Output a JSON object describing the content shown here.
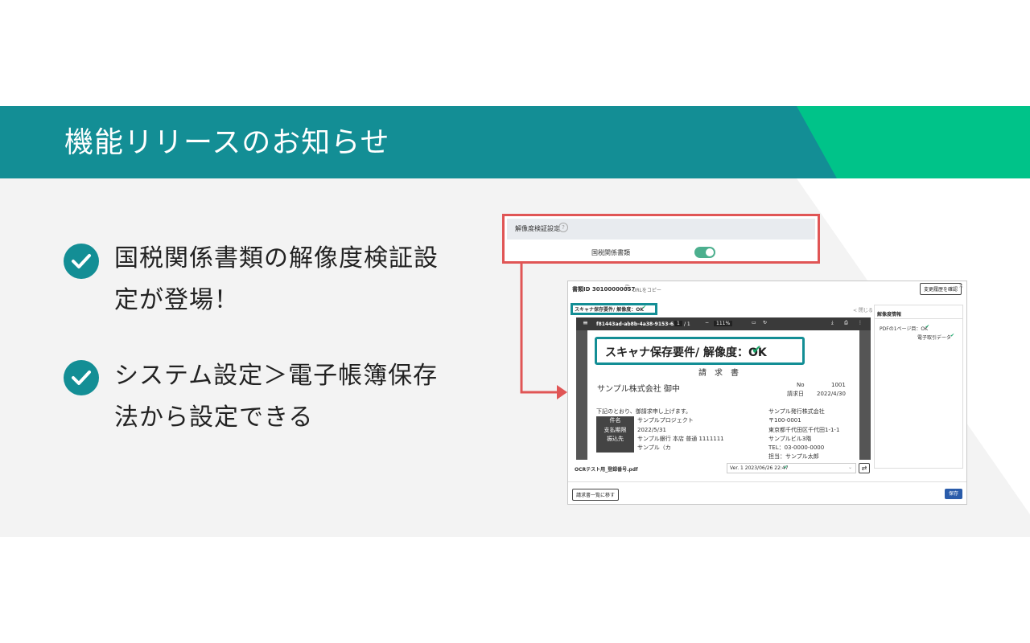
{
  "colors": {
    "teal": "#138e95",
    "green": "#00c389",
    "red_frame": "#e05555",
    "check": "#1aa86b"
  },
  "banner": {
    "title": "機能リリースのお知らせ"
  },
  "bullets": [
    {
      "icon": "check-circle-icon",
      "text": "国税関係書類の解像度検証設定が登場！"
    },
    {
      "icon": "check-circle-icon",
      "text": "システム設定＞電子帳簿保存法から設定できる"
    }
  ],
  "settings_panel": {
    "title": "解像度検証設定",
    "help": "?",
    "label": "国税関係書類",
    "toggle_on": true
  },
  "window": {
    "doc_id": "書類ID 30100000057",
    "copy_url": "URLをコピー",
    "history_button": "変更履歴を確認",
    "close": "×",
    "status_label": "スキャナ保存要件/ 解像度：OK",
    "collapse": "< 閉じる",
    "pdf": {
      "filename": "f81443ad-ab8b-4a38-9153-6...",
      "page": "1",
      "pages": "/ 1",
      "zoom": "111%"
    },
    "callout": "スキャナ保存要件/ 解像度：OK",
    "document": {
      "title": "請　求　書",
      "customer": "サンプル株式会社 御中",
      "no_label": "No",
      "no_value": "1001",
      "date_label": "請求日",
      "date_value": "2022/4/30",
      "intro": "下記のとおり、御請求申し上げます。",
      "rows": [
        {
          "label": "件名",
          "value": "サンプルプロジェクト"
        },
        {
          "label": "支払期限",
          "value": "2022/5/31"
        },
        {
          "label": "振込先",
          "value": "サンプル銀行 本店 普通 1111111"
        }
      ],
      "extra": "サンプル（カ",
      "issuer": [
        "サンプル発行株式会社",
        "〒100-0001",
        "東京都千代田区千代田1-1-1",
        "サンプルビル3階",
        "TEL：03-0000-0000",
        "担当：サンプル太郎"
      ]
    },
    "side": {
      "title": "解像度情報",
      "line1": "PDFの1ページ目：OK",
      "line2": "電子取引データ"
    },
    "file_name": "OCRテスト用_登録番号.pdf",
    "version": "Ver. 1  2023/06/26 22:47",
    "back_button": "請求書一覧に移す",
    "save_button": "保存"
  }
}
